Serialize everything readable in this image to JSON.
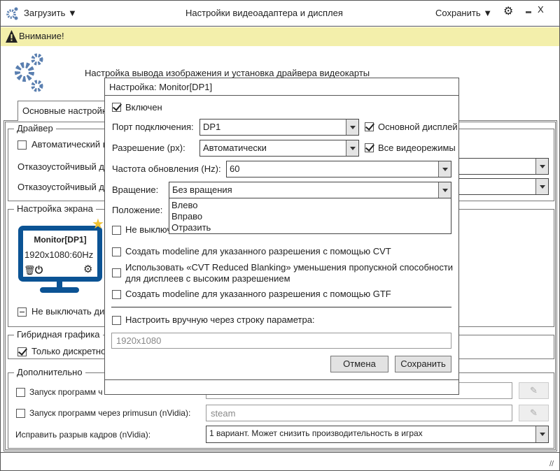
{
  "titlebar": {
    "load_label": "Загрузить",
    "title": "Настройки видеоадаптера и дисплея",
    "save_label": "Сохранить",
    "close_label": "X"
  },
  "warning": {
    "text": "Внимание!",
    "bg_color": "#f3efab"
  },
  "header": {
    "text": "Настройка вывода изображения и установка драйвера видеокарты",
    "icon_color": "#5a7fb0"
  },
  "tabs": [
    {
      "label": "Основные настройки"
    }
  ],
  "driver": {
    "legend": "Драйвер",
    "auto_label": "Автоматический в",
    "failsafe1_label": "Отказоустойчивый др",
    "failsafe2_label": "Отказоустойчивый др"
  },
  "screen": {
    "legend": "Настройка экрана",
    "monitor": {
      "name": "Monitor[DP1]",
      "mode": "1920x1080:60Hz",
      "color": "#0b5394",
      "star_color": "#f1c232"
    },
    "keep_on_label": "Не выключать ди"
  },
  "hybrid": {
    "legend": "Гибридная графика",
    "discrete_label": "Только дискретно"
  },
  "extra": {
    "legend": "Дополнительно",
    "row1_label": "Запуск программ ч",
    "row2_label": "Запуск программ через primusun (nVidia):",
    "row2_placeholder": "steam",
    "row3_label": "Исправить разрыв кадров (nVidia):",
    "row3_value": "1 вариант. Может снизить производительность в играх"
  },
  "dialog": {
    "title": "Настройка: Monitor[DP1]",
    "enabled_label": "Включен",
    "port_label": "Порт подключения:",
    "port_value": "DP1",
    "primary_label": "Основной дисплей",
    "res_label": "Разрешение (px):",
    "res_value": "Автоматически",
    "allmodes_label": "Все видеорежимы",
    "rate_label": "Частота обновления (Hz):",
    "rate_value": "60",
    "rot_label": "Вращение:",
    "rot_value": "Без вращения",
    "rot_options": [
      "Влево",
      "Вправо",
      "Отразить"
    ],
    "pos_label": "Положение:",
    "keep_label": "Не выключ",
    "cvt_label": "Создать modeline для указанного разрешения с помощью CVT",
    "rb_label1": "Использовать «CVT Reduced Blanking» уменьшения пропускной способности",
    "rb_label2": "для дисплеев с высоким разрешением",
    "gtf_label": "Создать modeline для указанного разрешения с помощью GTF",
    "manual_label": "Настроить вручную через строку параметра:",
    "manual_placeholder": "1920x1080",
    "cancel_label": "Отмена",
    "save_label": "Сохранить"
  }
}
